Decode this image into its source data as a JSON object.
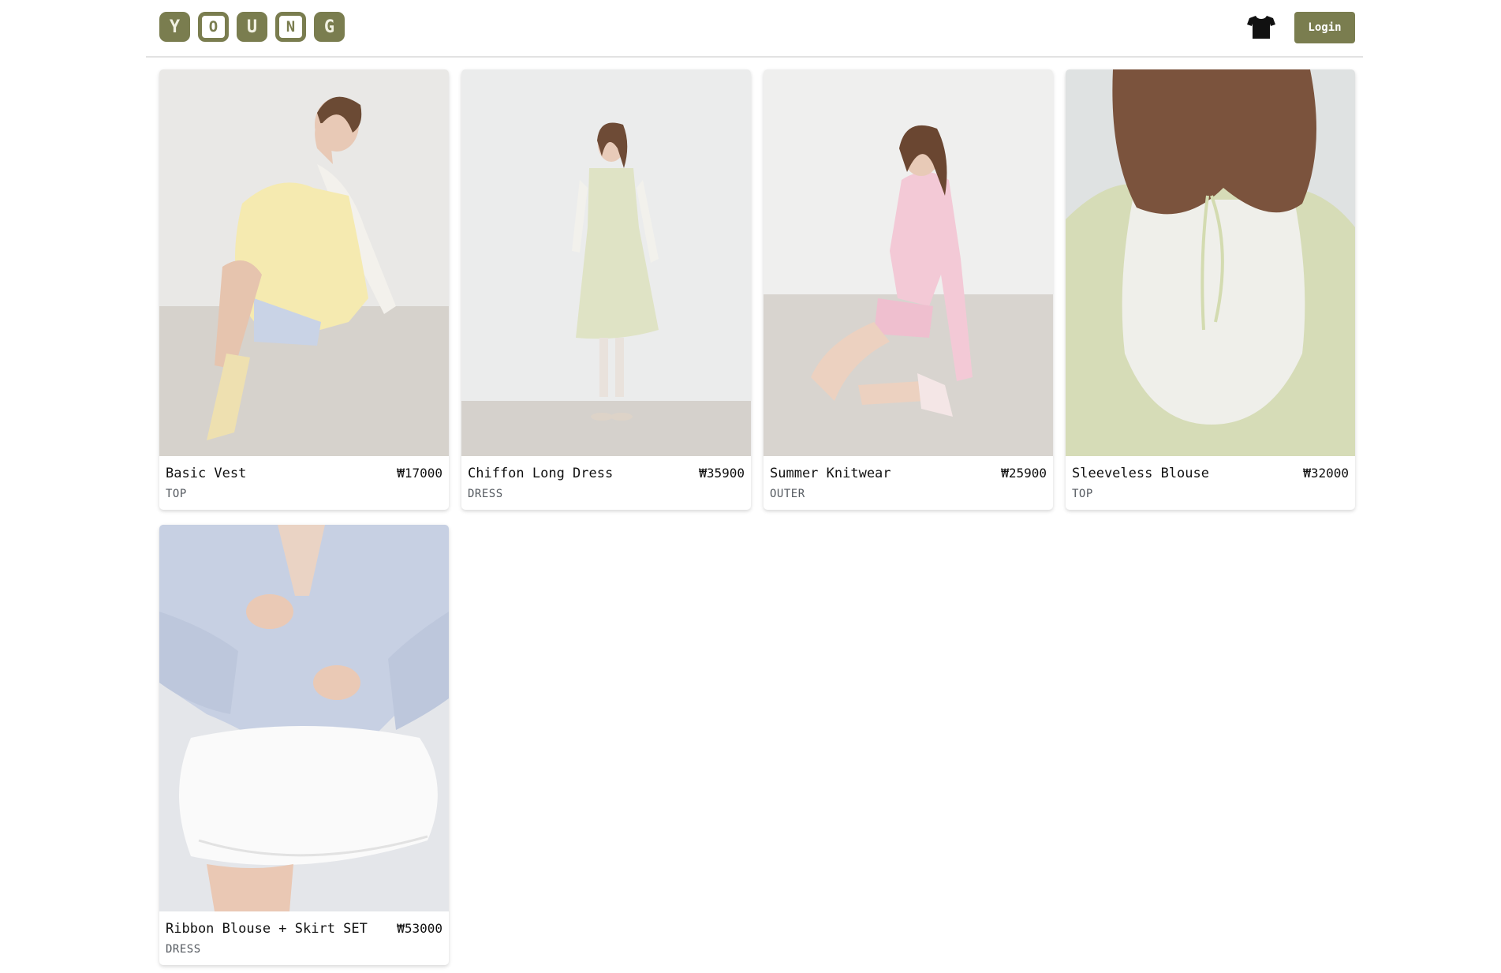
{
  "header": {
    "logo_letters": [
      "Y",
      "O",
      "U",
      "N",
      "G"
    ],
    "cart_icon": "tshirt-icon",
    "login_label": "Login"
  },
  "products": [
    {
      "name": "Basic Vest",
      "price": "₩17000",
      "category": "TOP",
      "image": "model-yellow-knit-vest"
    },
    {
      "name": "Chiffon Long Dress",
      "price": "₩35900",
      "category": "DRESS",
      "image": "model-green-long-dress"
    },
    {
      "name": "Summer Knitwear",
      "price": "₩25900",
      "category": "OUTER",
      "image": "model-pink-cardigan"
    },
    {
      "name": "Sleeveless Blouse",
      "price": "₩32000",
      "category": "TOP",
      "image": "back-green-sleeveless-blouse"
    },
    {
      "name": "Ribbon Blouse + Skirt SET",
      "price": "₩53000",
      "category": "DRESS",
      "image": "blue-ribbon-blouse-white-skirt"
    }
  ],
  "colors": {
    "brand": "#7a7d4f",
    "category_text": "#555a60"
  }
}
